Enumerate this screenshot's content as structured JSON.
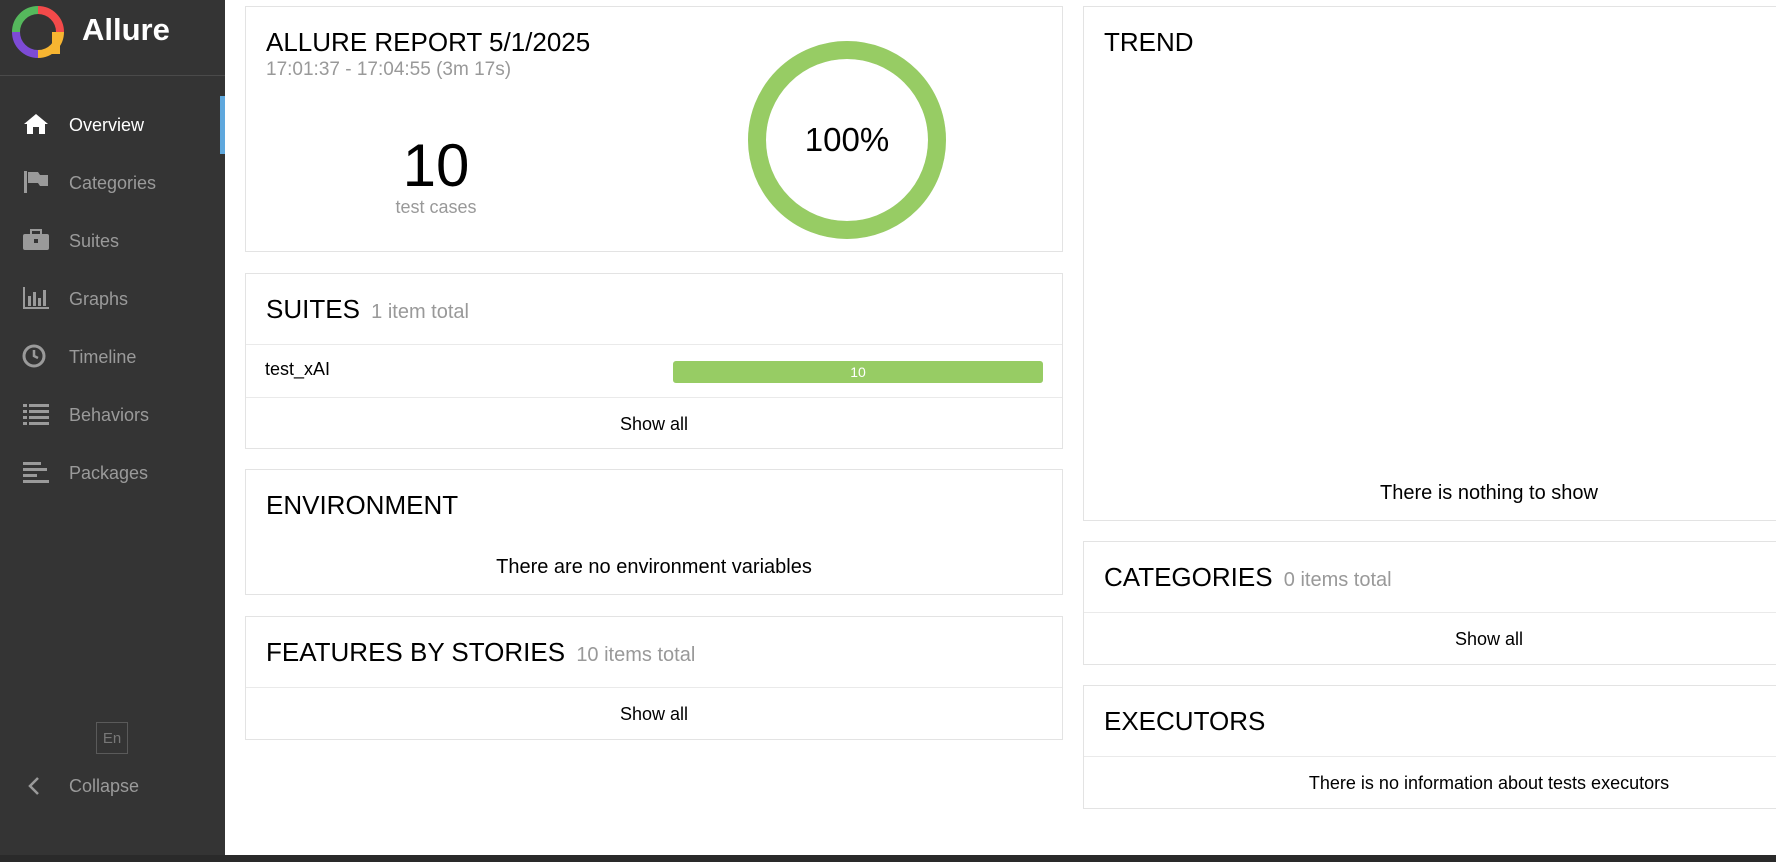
{
  "app": {
    "name": "Allure"
  },
  "sidebar": {
    "items": [
      {
        "label": "Overview",
        "icon": "home-icon",
        "active": true
      },
      {
        "label": "Categories",
        "icon": "flag-icon",
        "active": false
      },
      {
        "label": "Suites",
        "icon": "briefcase-icon",
        "active": false
      },
      {
        "label": "Graphs",
        "icon": "bar-chart-icon",
        "active": false
      },
      {
        "label": "Timeline",
        "icon": "clock-icon",
        "active": false
      },
      {
        "label": "Behaviors",
        "icon": "list-icon",
        "active": false
      },
      {
        "label": "Packages",
        "icon": "align-left-icon",
        "active": false
      }
    ],
    "language": "En",
    "collapse_label": "Collapse"
  },
  "summary": {
    "title": "ALLURE REPORT 5/1/2025",
    "time_range": "17:01:37 - 17:04:55 (3m 17s)",
    "test_count": "10",
    "test_count_label": "test cases",
    "pass_rate_text": "100%",
    "pass_rate": 1.0
  },
  "suites": {
    "title": "SUITES",
    "count_label": "1 item total",
    "rows": [
      {
        "name": "test_xAI",
        "passed": 10,
        "bar_label": "10"
      }
    ],
    "show_all": "Show all"
  },
  "environment": {
    "title": "ENVIRONMENT",
    "empty_text": "There are no environment variables"
  },
  "features": {
    "title": "FEATURES BY STORIES",
    "count_label": "10 items total",
    "show_all": "Show all"
  },
  "trend": {
    "title": "TREND",
    "empty_text": "There is nothing to show"
  },
  "categories": {
    "title": "CATEGORIES",
    "count_label": "0 items total",
    "show_all": "Show all"
  },
  "executors": {
    "title": "EXECUTORS",
    "empty_text": "There is no information about tests executors"
  },
  "colors": {
    "sidebar_bg": "#343434",
    "active_accent": "#5fa8dd",
    "passed": "#97cc64"
  }
}
